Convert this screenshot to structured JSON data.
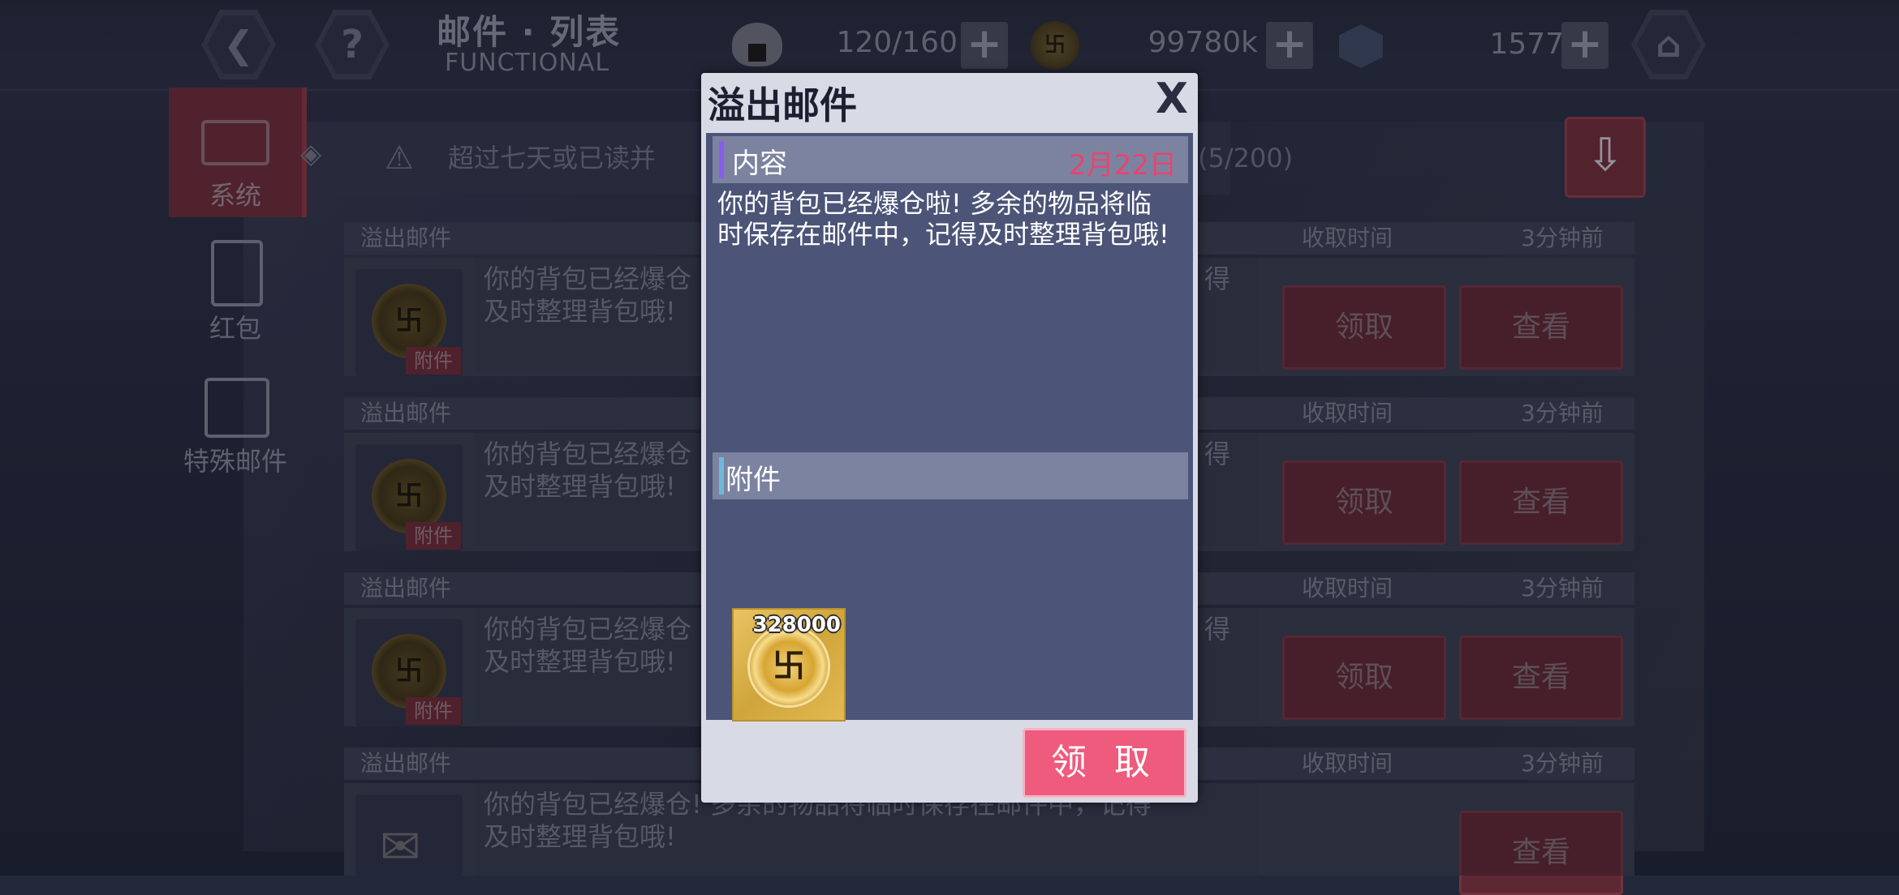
{
  "header": {
    "title": "邮件 · 列表",
    "subtitle": "FUNCTIONAL",
    "back_icon": "back-icon",
    "help_icon": "help-icon",
    "home_icon": "home-icon",
    "stamina": "120/160",
    "gold": "99780k",
    "gems": "15770"
  },
  "sidebar": {
    "items": [
      {
        "label": "系统",
        "icon": "mail-icon",
        "selected": true
      },
      {
        "label": "红包",
        "icon": "red-envelope-icon",
        "selected": false
      },
      {
        "label": "特殊邮件",
        "icon": "special-mail-icon",
        "selected": false
      }
    ]
  },
  "notice": {
    "text": "超过七天或已读并",
    "count_suffix": "(5/200)"
  },
  "mail_list": {
    "rows": [
      {
        "title": "溢出邮件",
        "time_label": "收取时间",
        "time": "3分钟前",
        "line1": "你的背包已经爆仓",
        "line1_end": "得",
        "line2": "及时整理背包哦!",
        "tag": "附件",
        "claim": "领取",
        "view": "查看"
      },
      {
        "title": "溢出邮件",
        "time_label": "收取时间",
        "time": "3分钟前",
        "line1": "你的背包已经爆仓",
        "line1_end": "得",
        "line2": "及时整理背包哦!",
        "tag": "附件",
        "claim": "领取",
        "view": "查看"
      },
      {
        "title": "溢出邮件",
        "time_label": "收取时间",
        "time": "3分钟前",
        "line1": "你的背包已经爆仓",
        "line1_end": "得",
        "line2": "及时整理背包哦!",
        "tag": "附件",
        "claim": "领取",
        "view": "查看"
      },
      {
        "title": "溢出邮件",
        "time_label": "收取时间",
        "time": "3分钟前",
        "line1": "你的背包已经爆仓! 多余的物品将临时保存在邮件中，记得",
        "line2": "及时整理背包哦!",
        "view": "查看"
      }
    ]
  },
  "modal": {
    "title": "溢出邮件",
    "close": "X",
    "content_label": "内容",
    "date": "2月22日",
    "content_text": "你的背包已经爆仓啦! 多余的物品将临时保存在邮件中，记得及时整理背包哦!",
    "attachment_label": "附件",
    "attachment_count": "328000",
    "claim_button": "领 取",
    "colors": {
      "accent": "#ee5b7d",
      "date": "#e8446e",
      "body": "#4c5478"
    }
  }
}
